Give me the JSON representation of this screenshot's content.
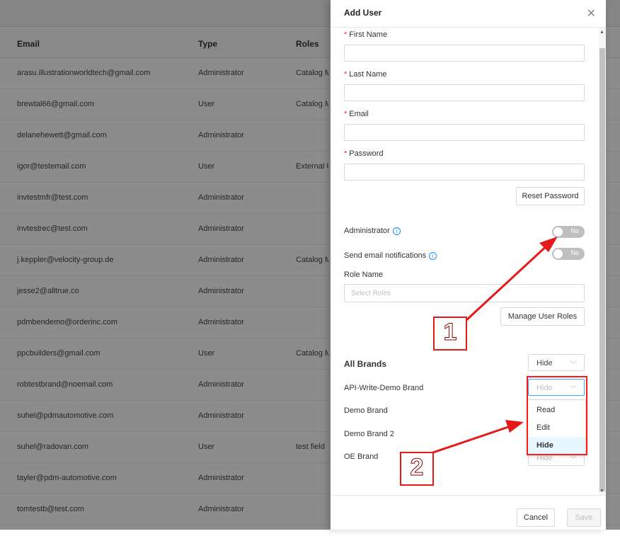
{
  "table": {
    "headers": {
      "email": "Email",
      "type": "Type",
      "roles": "Roles"
    },
    "rows": [
      {
        "email": "arasu.illustrationworldtech@gmail.com",
        "type": "Administrator",
        "roles": "Catalog M"
      },
      {
        "email": "brewtal66@gmail.com",
        "type": "User",
        "roles": "Catalog M"
      },
      {
        "email": "delanehewett@gmail.com",
        "type": "Administrator",
        "roles": ""
      },
      {
        "email": "igor@testemail.com",
        "type": "User",
        "roles": "External U"
      },
      {
        "email": "invtestmfr@test.com",
        "type": "Administrator",
        "roles": ""
      },
      {
        "email": "invtestrec@test.com",
        "type": "Administrator",
        "roles": ""
      },
      {
        "email": "j.keppler@velocity-group.de",
        "type": "Administrator",
        "roles": "Catalog M"
      },
      {
        "email": "jesse2@alltrue.co",
        "type": "Administrator",
        "roles": ""
      },
      {
        "email": "pdmbendemo@orderinc.com",
        "type": "Administrator",
        "roles": ""
      },
      {
        "email": "ppcbuilders@gmail.com",
        "type": "User",
        "roles": "Catalog M"
      },
      {
        "email": "robtestbrand@noemail.com",
        "type": "Administrator",
        "roles": ""
      },
      {
        "email": "suhel@pdmautomotive.com",
        "type": "Administrator",
        "roles": ""
      },
      {
        "email": "suhel@radovan.com",
        "type": "User",
        "roles": "test field"
      },
      {
        "email": "tayler@pdm-automotive.com",
        "type": "Administrator",
        "roles": ""
      },
      {
        "email": "tomtestb@test.com",
        "type": "Administrator",
        "roles": ""
      }
    ]
  },
  "drawer": {
    "title": "Add User",
    "close": "✕",
    "fields": {
      "first_name": "First Name",
      "last_name": "Last Name",
      "email": "Email",
      "password": "Password",
      "required_mark": "*"
    },
    "reset_password": "Reset Password",
    "administrator_label": "Administrator",
    "administrator_toggle": "No",
    "notifications_label": "Send email notifications",
    "notifications_toggle": "No",
    "info_glyph": "i",
    "role_name_label": "Role Name",
    "role_placeholder": "Select Roles",
    "manage_roles": "Manage User Roles",
    "all_brands_label": "All Brands",
    "all_brands_value": "Hide",
    "brands": [
      {
        "name": "API-Write-Demo Brand",
        "value": "Hide"
      },
      {
        "name": "Demo Brand",
        "value": ""
      },
      {
        "name": "Demo Brand 2",
        "value": ""
      },
      {
        "name": "OE Brand",
        "value": "Hide"
      }
    ],
    "dropdown_options": [
      "Read",
      "Edit",
      "Hide"
    ],
    "dropdown_selected": "Hide",
    "cancel": "Cancel",
    "save": "Save"
  },
  "annotations": {
    "callout_1": "1",
    "callout_2": "2",
    "color": "#e61919"
  }
}
